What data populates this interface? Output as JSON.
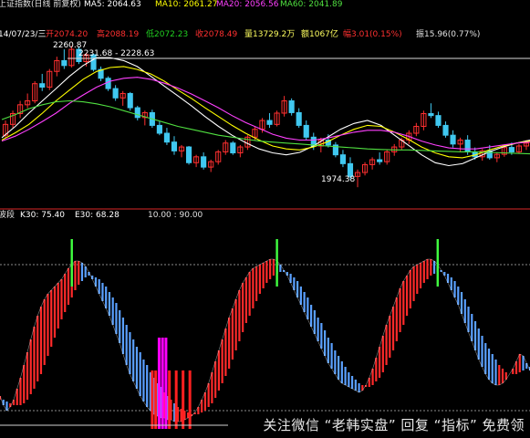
{
  "chart_data": [
    {
      "type": "candlestick",
      "header": {
        "name": "上证指数(日线 前复权)",
        "ma5": "MA5: 2064.63",
        "ma10": "MA10: 2061.27",
        "ma20": "MA20: 2056.56",
        "ma60": "MA60: 2041.89"
      },
      "info": {
        "date": "14/07/23/三",
        "open": "开2074.20",
        "high": "高2088.19",
        "low": "低2072.23",
        "close": "收2078.49",
        "volume": "量13729.2万",
        "amount": "额1067亿",
        "change": "幅3.01(0.15%)",
        "amplitude": "振15.96(0.77%)"
      },
      "annotations": {
        "high_label": "2260.87",
        "range_label": "2231.68 - 2228.63",
        "low_label": "1974.38"
      },
      "ylim": [
        1965,
        2270
      ],
      "resistance_line": 2235,
      "candles": [
        [
          2080,
          2110,
          2075,
          2102
        ],
        [
          2102,
          2130,
          2095,
          2124
        ],
        [
          2124,
          2150,
          2115,
          2142
        ],
        [
          2142,
          2165,
          2135,
          2150
        ],
        [
          2150,
          2190,
          2145,
          2185
        ],
        [
          2185,
          2205,
          2170,
          2178
        ],
        [
          2178,
          2215,
          2172,
          2210
        ],
        [
          2210,
          2240,
          2200,
          2232
        ],
        [
          2232,
          2255,
          2215,
          2222
        ],
        [
          2222,
          2262,
          2218,
          2255
        ],
        [
          2255,
          2261,
          2225,
          2230
        ],
        [
          2230,
          2248,
          2220,
          2244
        ],
        [
          2244,
          2246,
          2210,
          2214
        ],
        [
          2214,
          2220,
          2190,
          2196
        ],
        [
          2196,
          2200,
          2170,
          2175
        ],
        [
          2175,
          2182,
          2150,
          2156
        ],
        [
          2156,
          2170,
          2140,
          2165
        ],
        [
          2165,
          2168,
          2130,
          2136
        ],
        [
          2136,
          2140,
          2110,
          2116
        ],
        [
          2116,
          2130,
          2100,
          2126
        ],
        [
          2126,
          2132,
          2095,
          2100
        ],
        [
          2100,
          2108,
          2080,
          2084
        ],
        [
          2084,
          2095,
          2060,
          2066
        ],
        [
          2066,
          2078,
          2040,
          2048
        ],
        [
          2048,
          2060,
          2035,
          2056
        ],
        [
          2056,
          2058,
          2020,
          2024
        ],
        [
          2024,
          2040,
          2015,
          2036
        ],
        [
          2036,
          2045,
          2010,
          2015
        ],
        [
          2015,
          2030,
          2005,
          2026
        ],
        [
          2026,
          2050,
          2020,
          2046
        ],
        [
          2046,
          2070,
          2040,
          2064
        ],
        [
          2064,
          2068,
          2040,
          2044
        ],
        [
          2044,
          2060,
          2035,
          2056
        ],
        [
          2056,
          2080,
          2050,
          2076
        ],
        [
          2076,
          2098,
          2070,
          2092
        ],
        [
          2092,
          2115,
          2085,
          2110
        ],
        [
          2110,
          2125,
          2095,
          2102
        ],
        [
          2102,
          2130,
          2098,
          2125
        ],
        [
          2125,
          2160,
          2118,
          2150
        ],
        [
          2150,
          2155,
          2120,
          2126
        ],
        [
          2126,
          2135,
          2095,
          2100
        ],
        [
          2100,
          2110,
          2070,
          2076
        ],
        [
          2076,
          2085,
          2050,
          2058
        ],
        [
          2058,
          2075,
          2045,
          2070
        ],
        [
          2070,
          2082,
          2055,
          2060
        ],
        [
          2060,
          2066,
          2035,
          2040
        ],
        [
          2040,
          2050,
          2015,
          2022
        ],
        [
          2022,
          2035,
          1990,
          1996
        ],
        [
          1996,
          2010,
          1974,
          2004
        ],
        [
          2004,
          2025,
          1998,
          2020
        ],
        [
          2020,
          2035,
          2010,
          2030
        ],
        [
          2030,
          2045,
          2020,
          2026
        ],
        [
          2026,
          2050,
          2020,
          2046
        ],
        [
          2046,
          2062,
          2038,
          2056
        ],
        [
          2056,
          2075,
          2050,
          2070
        ],
        [
          2070,
          2090,
          2062,
          2084
        ],
        [
          2084,
          2105,
          2078,
          2098
        ],
        [
          2098,
          2130,
          2090,
          2124
        ],
        [
          2124,
          2145,
          2115,
          2120
        ],
        [
          2120,
          2128,
          2095,
          2100
        ],
        [
          2100,
          2108,
          2075,
          2080
        ],
        [
          2080,
          2090,
          2055,
          2062
        ],
        [
          2062,
          2075,
          2045,
          2070
        ],
        [
          2070,
          2080,
          2040,
          2046
        ],
        [
          2046,
          2055,
          2030,
          2036
        ],
        [
          2036,
          2052,
          2028,
          2048
        ],
        [
          2048,
          2060,
          2030,
          2034
        ],
        [
          2034,
          2045,
          2025,
          2041
        ],
        [
          2041,
          2058,
          2036,
          2055
        ],
        [
          2055,
          2065,
          2040,
          2046
        ],
        [
          2046,
          2062,
          2042,
          2058
        ],
        [
          2058,
          2070,
          2050,
          2064
        ]
      ],
      "ma_series": [
        {
          "color": "#ffffff",
          "values": [
            2075,
            2098,
            2125,
            2150,
            2175,
            2200,
            2222,
            2238,
            2238,
            2232,
            2220,
            2200,
            2180,
            2160,
            2140,
            2118,
            2098,
            2080,
            2065,
            2052,
            2044,
            2040,
            2045,
            2058,
            2075,
            2092,
            2104,
            2110,
            2100,
            2080,
            2060,
            2040,
            2024,
            2018,
            2022,
            2034,
            2046,
            2056,
            2064,
            2070
          ]
        },
        {
          "color": "#ffff00",
          "values": [
            2070,
            2085,
            2102,
            2125,
            2150,
            2172,
            2194,
            2210,
            2218,
            2220,
            2214,
            2205,
            2190,
            2172,
            2155,
            2136,
            2118,
            2100,
            2084,
            2070,
            2058,
            2052,
            2050,
            2056,
            2066,
            2080,
            2092,
            2100,
            2098,
            2086,
            2072,
            2056,
            2044,
            2036,
            2034,
            2040,
            2050,
            2058,
            2064,
            2068
          ]
        },
        {
          "color": "#ff40ff",
          "values": [
            2068,
            2078,
            2092,
            2108,
            2125,
            2145,
            2162,
            2178,
            2190,
            2196,
            2198,
            2194,
            2186,
            2176,
            2164,
            2150,
            2136,
            2120,
            2106,
            2094,
            2082,
            2074,
            2070,
            2070,
            2074,
            2080,
            2086,
            2090,
            2090,
            2086,
            2078,
            2068,
            2060,
            2054,
            2052,
            2052,
            2056,
            2060,
            2064,
            2066
          ]
        },
        {
          "color": "#50e040",
          "values": [
            2112,
            2122,
            2134,
            2142,
            2148,
            2150,
            2148,
            2144,
            2138,
            2130,
            2122,
            2114,
            2106,
            2098,
            2092,
            2086,
            2080,
            2076,
            2072,
            2068,
            2066,
            2064,
            2062,
            2060,
            2058,
            2056,
            2054,
            2052,
            2051,
            2050,
            2050,
            2049,
            2048,
            2047,
            2046,
            2046,
            2045,
            2044,
            2043,
            2042
          ]
        }
      ]
    },
    {
      "type": "oscillator",
      "header": {
        "name": "波段",
        "k": "K30: 75.40",
        "e": "E30: 68.28",
        "extra": "10.00 : 90.00"
      },
      "ylim": [
        0,
        100
      ],
      "reference_levels": [
        10,
        90
      ],
      "signal_marks_at": [
        21,
        81,
        128
      ],
      "k_values": [
        18,
        13,
        10,
        12,
        16,
        22,
        28,
        35,
        42,
        49,
        56,
        62,
        67,
        71,
        74,
        76,
        78,
        80,
        82,
        85,
        88,
        90,
        92,
        92,
        91,
        89,
        86,
        82,
        78,
        74,
        70,
        66,
        62,
        57,
        52,
        47,
        41,
        35,
        30,
        26,
        22,
        18,
        15,
        12,
        10,
        8,
        7,
        6,
        6,
        5,
        5,
        4,
        4,
        4,
        5,
        6,
        7,
        9,
        12,
        16,
        20,
        25,
        31,
        37,
        43,
        49,
        55,
        61,
        66,
        71,
        76,
        80,
        83,
        86,
        88,
        89,
        90,
        91,
        92,
        93,
        93,
        92,
        90,
        87,
        84,
        80,
        76,
        72,
        68,
        64,
        60,
        56,
        52,
        48,
        44,
        40,
        36,
        33,
        30,
        27,
        25,
        24,
        23,
        22,
        21,
        20,
        21,
        24,
        28,
        33,
        39,
        45,
        51,
        57,
        62,
        67,
        72,
        77,
        81,
        84,
        87,
        89,
        90,
        91,
        92,
        93,
        93,
        92,
        90,
        87,
        84,
        80,
        76,
        72,
        68,
        63,
        58,
        53,
        48,
        43,
        38,
        34,
        30,
        27,
        25,
        24,
        24,
        25,
        27,
        30,
        33,
        37,
        41,
        40,
        36,
        32
      ],
      "e_values": [
        16,
        16,
        15,
        14,
        13,
        13,
        13,
        14,
        16,
        19,
        22,
        26,
        30,
        35,
        40,
        45,
        50,
        55,
        60,
        64,
        68,
        72,
        76,
        79,
        81,
        83,
        84,
        84,
        83,
        82,
        80,
        78,
        75,
        72,
        69,
        65,
        61,
        57,
        53,
        49,
        45,
        42,
        38,
        35,
        31,
        28,
        25,
        23,
        20,
        18,
        16,
        14,
        12,
        11,
        10,
        9,
        8,
        8,
        8,
        9,
        10,
        12,
        14,
        17,
        21,
        25,
        29,
        33,
        38,
        43,
        48,
        53,
        58,
        62,
        66,
        70,
        74,
        77,
        80,
        82,
        84,
        85,
        86,
        86,
        86,
        85,
        83,
        81,
        78,
        75,
        72,
        68,
        65,
        61,
        58,
        54,
        50,
        47,
        43,
        40,
        37,
        34,
        31,
        29,
        27,
        25,
        24,
        23,
        23,
        24,
        26,
        28,
        31,
        35,
        39,
        43,
        48,
        53,
        57,
        62,
        66,
        70,
        74,
        77,
        80,
        82,
        84,
        85,
        86,
        86,
        86,
        85,
        83,
        81,
        78,
        75,
        71,
        67,
        63,
        59,
        55,
        51,
        47,
        44,
        41,
        38,
        35,
        33,
        31,
        30,
        30,
        30,
        31,
        32,
        33,
        34
      ],
      "volume_bars": [
        {
          "index": 45,
          "value": 50,
          "color": "#ff00ff"
        },
        {
          "index": 46,
          "value": 50,
          "color": "#ff00ff"
        },
        {
          "index": 47,
          "value": 50,
          "color": "#ff00ff"
        },
        {
          "index": 43,
          "value": 32,
          "color": "#ff2020"
        },
        {
          "index": 44,
          "value": 32,
          "color": "#ff2020"
        },
        {
          "index": 48,
          "value": 32,
          "color": "#ff2020"
        },
        {
          "index": 50,
          "value": 32,
          "color": "#ff2020"
        },
        {
          "index": 52,
          "value": 32,
          "color": "#ff2020"
        },
        {
          "index": 54,
          "value": 32,
          "color": "#ff2020"
        }
      ]
    }
  ],
  "watermark": "关注微信 “老韩实盘” 回复 “指标” 免费领"
}
